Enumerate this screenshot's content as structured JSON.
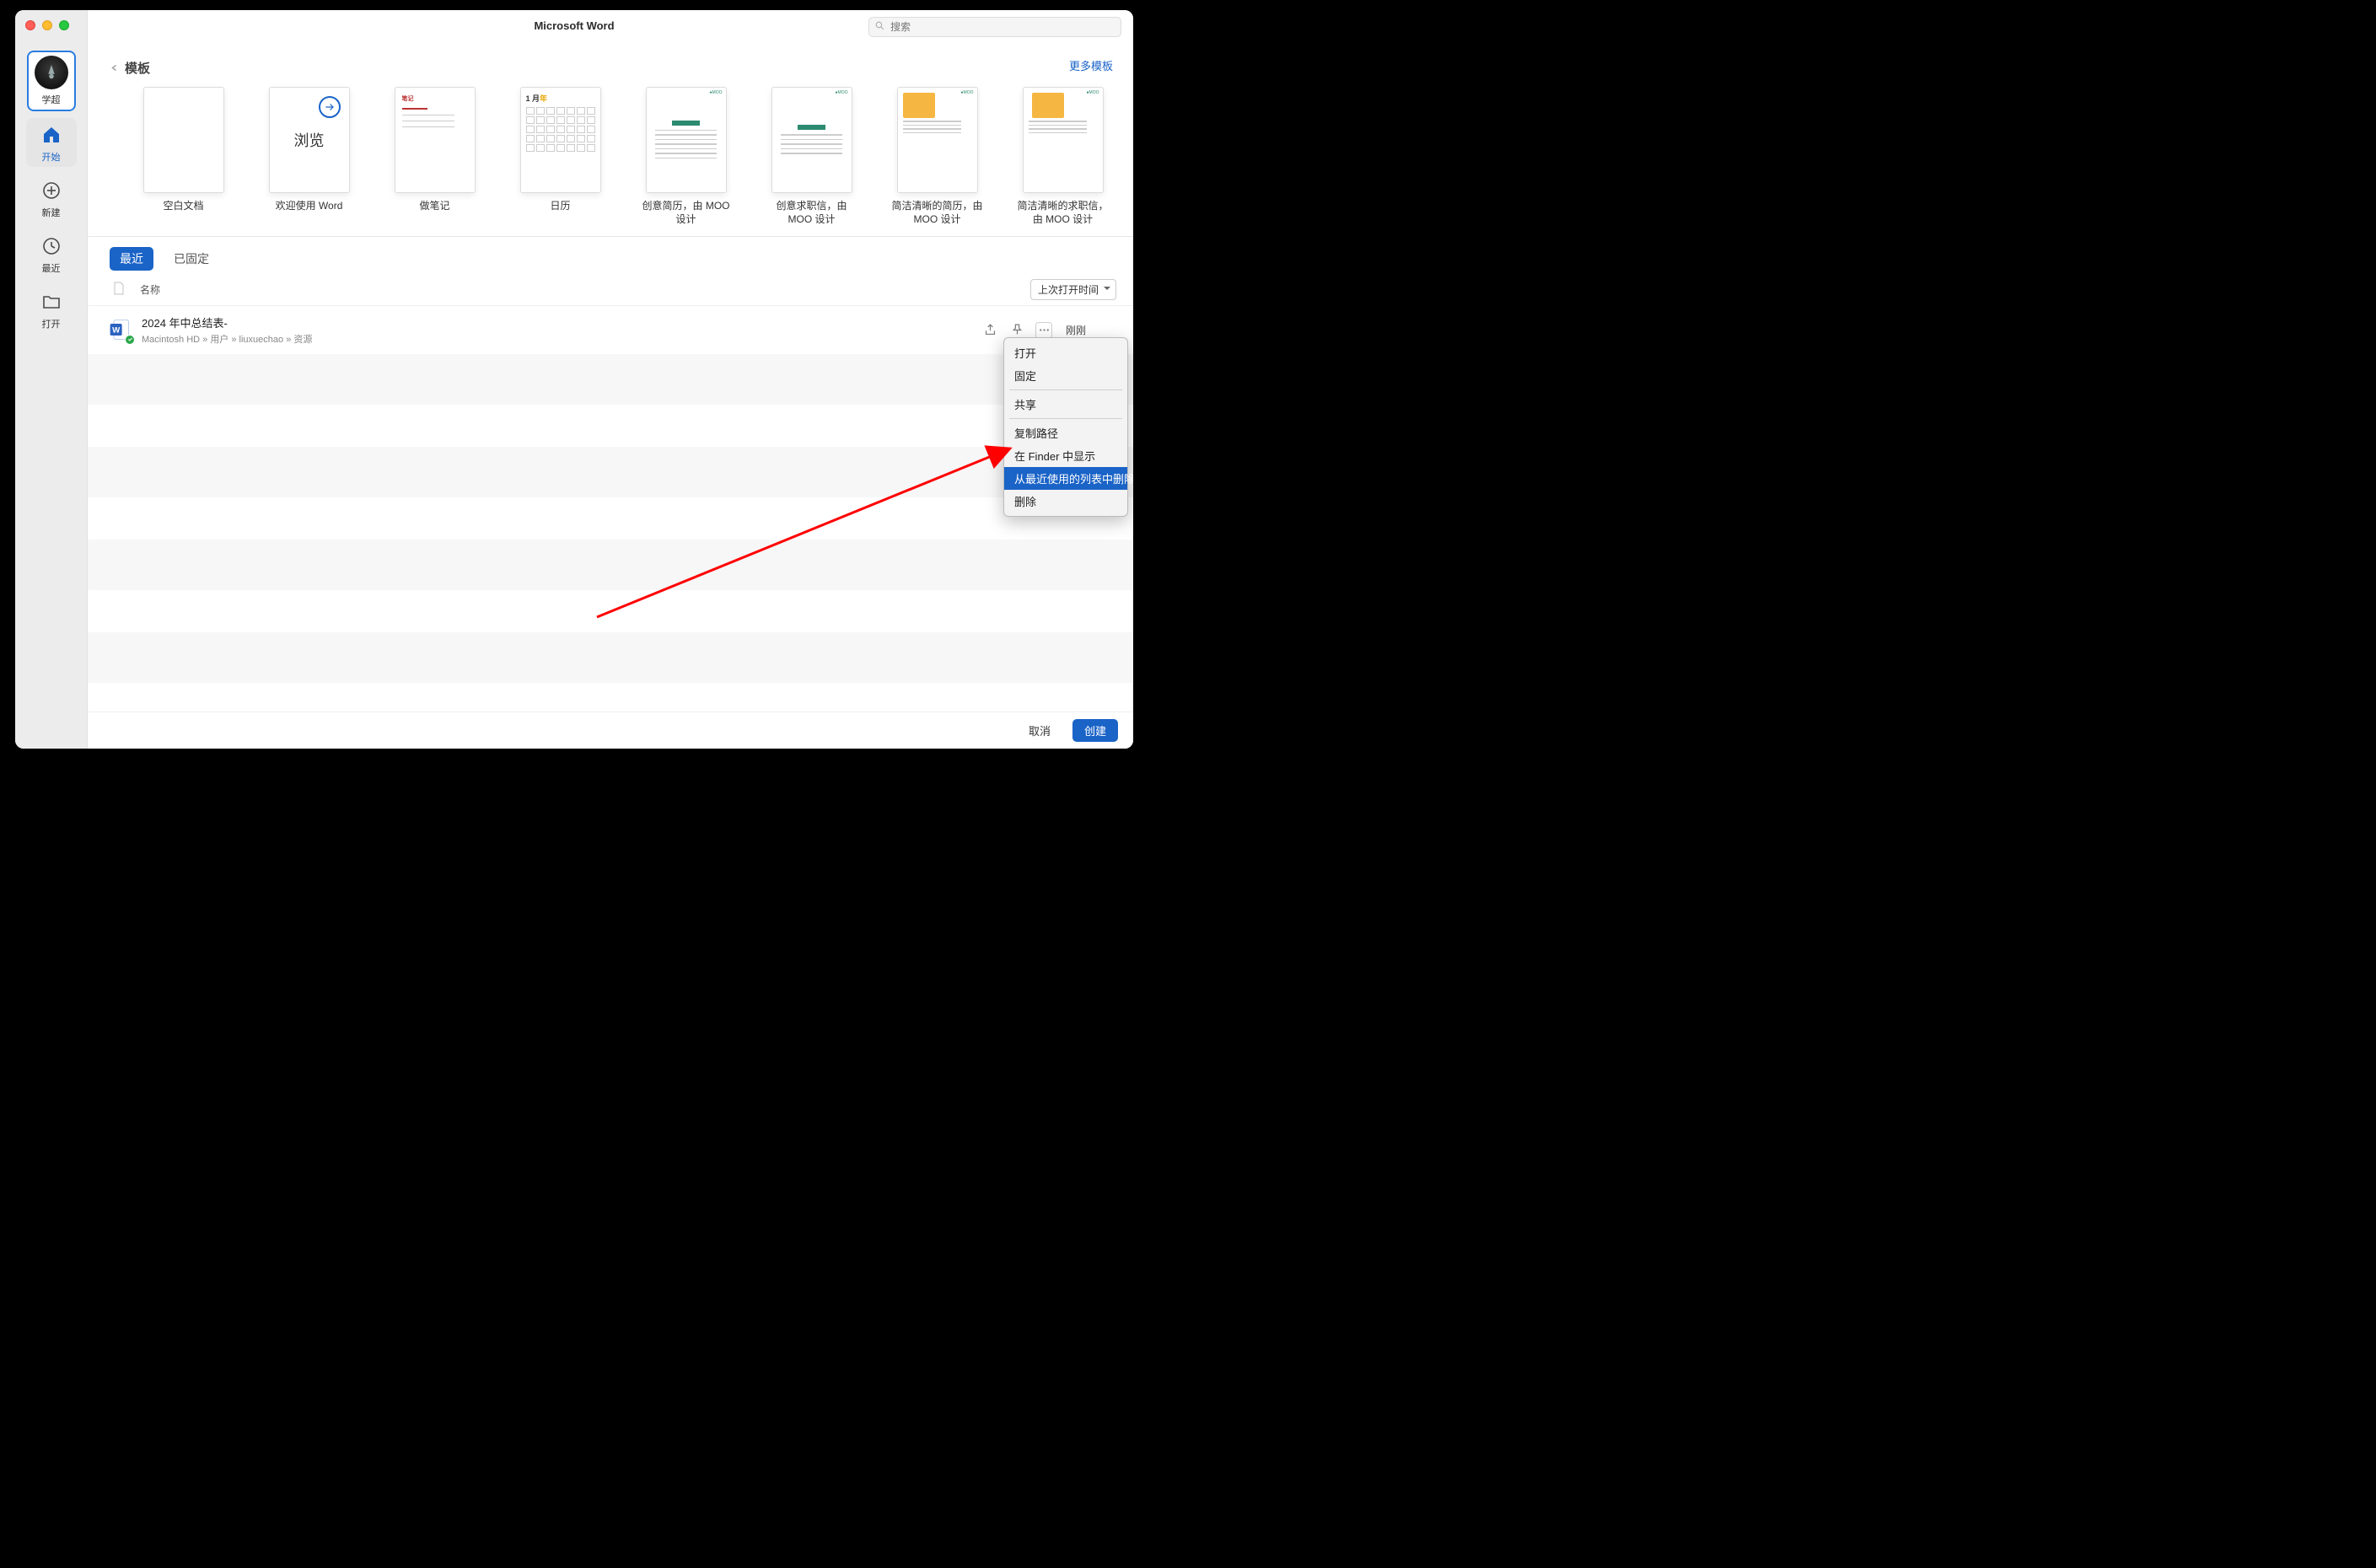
{
  "window": {
    "title": "Microsoft Word",
    "search_placeholder": "搜索"
  },
  "sidebar": {
    "user_label": "学超",
    "items": [
      {
        "id": "home",
        "label": "开始",
        "active": true
      },
      {
        "id": "new",
        "label": "新建",
        "active": false
      },
      {
        "id": "recent",
        "label": "最近",
        "active": false
      },
      {
        "id": "open",
        "label": "打开",
        "active": false
      }
    ]
  },
  "templates": {
    "section_title": "模板",
    "more_link": "更多模板",
    "browse_label": "浏览",
    "calendar_head_a": "1 月",
    "calendar_head_b": "年",
    "items": [
      {
        "name": "空白文档"
      },
      {
        "name": "欢迎使用 Word"
      },
      {
        "name": "做笔记"
      },
      {
        "name": "日历"
      },
      {
        "name": "创意简历，由 MOO 设计"
      },
      {
        "name": "创意求职信，由 MOO 设计"
      },
      {
        "name": "简洁清晰的简历，由 MOO 设计"
      },
      {
        "name": "简洁清晰的求职信，由 MOO 设计"
      }
    ]
  },
  "tabs": {
    "recent": "最近",
    "pinned": "已固定"
  },
  "list": {
    "col_name": "名称",
    "sort_label": "上次打开时间",
    "items": [
      {
        "title": "2024 年中总结表-",
        "path_parts": [
          "Macintosh HD",
          "用户",
          "liuxuechao",
          "资源"
        ],
        "time": "刚刚"
      }
    ]
  },
  "context_menu": {
    "open": "打开",
    "pin": "固定",
    "share": "共享",
    "copy_path": "复制路径",
    "reveal": "在 Finder 中显示",
    "remove_recent": "从最近使用的列表中删除",
    "delete": "删除"
  },
  "footer": {
    "cancel": "取消",
    "create": "创建"
  },
  "annotation": {
    "arrow_color": "#ff0000"
  }
}
